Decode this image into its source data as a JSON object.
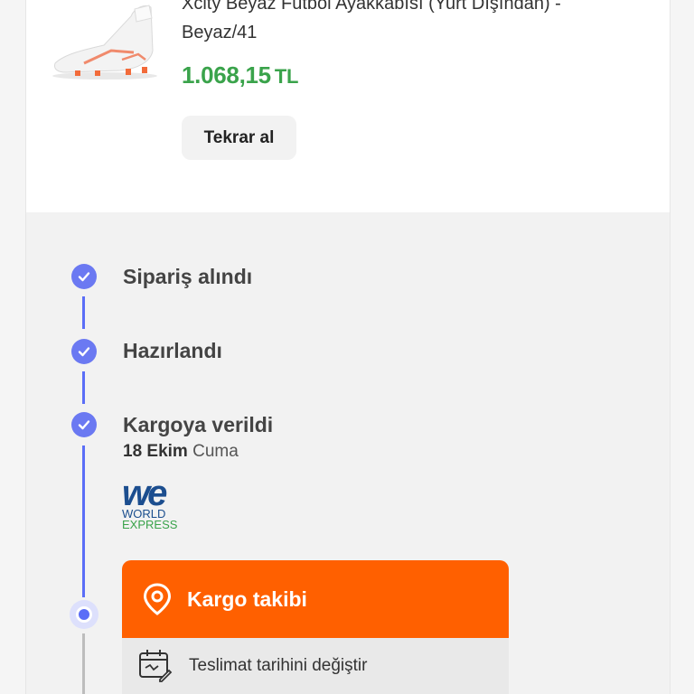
{
  "product": {
    "title_line1": "Xcity Beyaz Futbol Ayakkabısı (Yurt Dışından) -",
    "title_line2": "Beyaz/41",
    "price_amount": "1.068,15",
    "price_currency": "TL",
    "rebuy_label": "Tekrar al"
  },
  "timeline": {
    "steps": [
      {
        "label": "Sipariş alındı",
        "status": "done"
      },
      {
        "label": "Hazırlandı",
        "status": "done"
      },
      {
        "label": "Kargoya verildi",
        "status": "done",
        "date_bold": "18 Ekim",
        "date_rest": " Cuma"
      }
    ],
    "carrier": {
      "logo_text_1": "WORLD",
      "logo_text_2": "EXPRESS",
      "logo_mark": "we"
    },
    "track_label": "Kargo takibi",
    "change_date_label": "Teslimat tarihini değiştir"
  },
  "colors": {
    "accent_orange": "#ff6000",
    "price_green": "#3aa34b",
    "timeline_blue": "#5b6ef7"
  },
  "icons": [
    "check-icon",
    "location-pin-icon",
    "calendar-edit-icon"
  ]
}
